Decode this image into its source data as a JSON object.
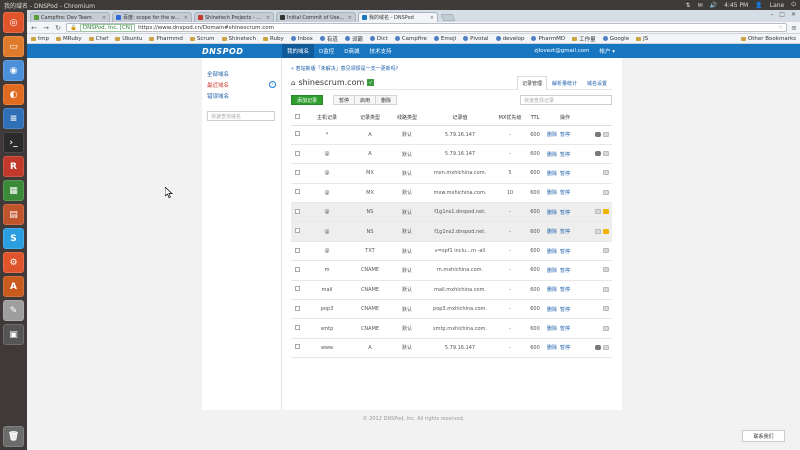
{
  "os_panel": {
    "window_title": "我的域名 - DNSPod - Chromium",
    "time": "4:45 PM",
    "user": "Lane"
  },
  "launcher": {
    "apps": [
      {
        "name": "dash-icon",
        "color": "#e0542c",
        "glyph": "◎"
      },
      {
        "name": "files-icon",
        "color": "#e07b2c",
        "glyph": "▭"
      },
      {
        "name": "chromium-icon",
        "color": "#4a8fd8",
        "glyph": "◉"
      },
      {
        "name": "firefox-icon",
        "color": "#e06a1f",
        "glyph": "◐"
      },
      {
        "name": "writer-icon",
        "color": "#2e6fb8",
        "glyph": "≡"
      },
      {
        "name": "terminal-icon",
        "color": "#2b2b2b",
        "glyph": "›_"
      },
      {
        "name": "rubymine-icon",
        "color": "#c0392b",
        "glyph": "R"
      },
      {
        "name": "calc-icon",
        "color": "#3a8a3a",
        "glyph": "▦"
      },
      {
        "name": "impress-icon",
        "color": "#c0542c",
        "glyph": "▤"
      },
      {
        "name": "skype-icon",
        "color": "#2a9ee0",
        "glyph": "S"
      },
      {
        "name": "settings-icon",
        "color": "#e0542c",
        "glyph": "⚙"
      },
      {
        "name": "software-center-icon",
        "color": "#c85a1e",
        "glyph": "A"
      },
      {
        "name": "editor-icon",
        "color": "#9e9e9e",
        "glyph": "✎"
      },
      {
        "name": "workspace-icon",
        "color": "#555555",
        "glyph": "▣"
      }
    ],
    "trash_glyph": "🗑"
  },
  "browser": {
    "tabs": [
      {
        "label": "Campfire: Dev Team",
        "fav": "#5a9e3a",
        "active": false
      },
      {
        "label": "百度: scope for the website",
        "fav": "#2f6bd8",
        "active": false
      },
      {
        "label": "Shinetech Projects - Pivotal",
        "fav": "#c43b30",
        "active": false
      },
      {
        "label": "Initial Commit of UserGuide",
        "fav": "#333333",
        "active": false
      },
      {
        "label": "我的域名 - DNSPod",
        "fav": "#1876c1",
        "active": true
      }
    ],
    "url_secure_label": "DNSPod, Inc. [CN]",
    "url": "https://www.dnspod.cn/Domain#shinescrum.com",
    "bookmarks": [
      {
        "label": "tmp",
        "type": "folder"
      },
      {
        "label": "MRuby",
        "type": "folder"
      },
      {
        "label": "Chef",
        "type": "folder"
      },
      {
        "label": "Ubuntu",
        "type": "folder"
      },
      {
        "label": "Pharmmd",
        "type": "folder"
      },
      {
        "label": "Scrum",
        "type": "folder"
      },
      {
        "label": "Shinetech",
        "type": "folder"
      },
      {
        "label": "Ruby",
        "type": "folder"
      },
      {
        "label": "Inbox",
        "type": "site"
      },
      {
        "label": "有道",
        "type": "site"
      },
      {
        "label": "词霸",
        "type": "site"
      },
      {
        "label": "Dict",
        "type": "site"
      },
      {
        "label": "Campfire",
        "type": "site"
      },
      {
        "label": "Emoji",
        "type": "site"
      },
      {
        "label": "Pivotal",
        "type": "site"
      },
      {
        "label": "develop",
        "type": "site"
      },
      {
        "label": "PharmMD",
        "type": "site"
      },
      {
        "label": "工作量",
        "type": "folder"
      },
      {
        "label": "Google",
        "type": "site"
      },
      {
        "label": "JS",
        "type": "folder"
      }
    ],
    "other_bookmarks": "Other Bookmarks"
  },
  "site": {
    "logo": "DNSPOD",
    "nav": [
      {
        "label": "我的域名",
        "active": true
      },
      {
        "label": "D监控",
        "active": false
      },
      {
        "label": "D商城",
        "active": false
      },
      {
        "label": "技术支持",
        "active": false
      }
    ],
    "user_email": "zjlovezt@gmail.com",
    "account_menu": "帐户 ▾",
    "sidebar": {
      "links": [
        {
          "label": "全部域名",
          "red": false
        },
        {
          "label": "最近域名",
          "red": true
        },
        {
          "label": "错误域名",
          "red": false
        }
      ],
      "search_placeholder": "快速查找域名"
    },
    "notice_prefix": "« 若站新版「未解决」意见领馈是一支一更新吗?",
    "domain": "shinescrum.com",
    "right_tabs": [
      {
        "label": "记录管理",
        "active": true
      },
      {
        "label": "解析量统计",
        "active": false
      },
      {
        "label": "域名设置",
        "active": false
      }
    ],
    "add_record": "添加记录",
    "bulk_actions": [
      "暂停",
      "启用",
      "删除"
    ],
    "record_search_placeholder": "快速查找记录",
    "table": {
      "headers": [
        "",
        "主机记录",
        "记录类型",
        "线路类型",
        "记录值",
        "MX优先级",
        "TTL",
        "操作",
        ""
      ],
      "op_delete": "删除",
      "op_pause": "暂停",
      "rows": [
        {
          "host": "*",
          "type": "A",
          "line": "默认",
          "value": "5.79.16.147",
          "mx": "-",
          "ttl": "600",
          "icons": [
            "cmt",
            "note"
          ]
        },
        {
          "host": "@",
          "type": "A",
          "line": "默认",
          "value": "5.79.16.147",
          "mx": "-",
          "ttl": "600",
          "icons": [
            "cmt",
            "note"
          ]
        },
        {
          "host": "@",
          "type": "MX",
          "line": "默认",
          "value": "mxn.mxhichina.com.",
          "mx": "5",
          "ttl": "600",
          "icons": [
            "note"
          ]
        },
        {
          "host": "@",
          "type": "MX",
          "line": "默认",
          "value": "mxw.mxhichina.com.",
          "mx": "10",
          "ttl": "600",
          "icons": [
            "note"
          ]
        },
        {
          "host": "@",
          "type": "NS",
          "line": "默认",
          "value": "f1g1ns1.dnspod.net.",
          "mx": "-",
          "ttl": "600",
          "icons": [
            "note",
            "lock"
          ],
          "ns": true
        },
        {
          "host": "@",
          "type": "NS",
          "line": "默认",
          "value": "f1g1ns2.dnspod.net.",
          "mx": "-",
          "ttl": "600",
          "icons": [
            "note",
            "lock"
          ],
          "ns": true
        },
        {
          "host": "@",
          "type": "TXT",
          "line": "默认",
          "value": "v=spf1 inclu…m -all",
          "mx": "-",
          "ttl": "600",
          "icons": [
            "note"
          ]
        },
        {
          "host": "m",
          "type": "CNAME",
          "line": "默认",
          "value": "m.mxhichina.com.",
          "mx": "-",
          "ttl": "600",
          "icons": [
            "note"
          ]
        },
        {
          "host": "mail",
          "type": "CNAME",
          "line": "默认",
          "value": "mail.mxhichina.com.",
          "mx": "-",
          "ttl": "600",
          "icons": [
            "note"
          ]
        },
        {
          "host": "pop3",
          "type": "CNAME",
          "line": "默认",
          "value": "pop3.mxhichina.com.",
          "mx": "-",
          "ttl": "600",
          "icons": [
            "note"
          ]
        },
        {
          "host": "smtp",
          "type": "CNAME",
          "line": "默认",
          "value": "smtp.mxhichina.com.",
          "mx": "-",
          "ttl": "600",
          "icons": [
            "note"
          ]
        },
        {
          "host": "www",
          "type": "A",
          "line": "默认",
          "value": "5.79.16.147",
          "mx": "-",
          "ttl": "600",
          "icons": [
            "cmt",
            "note"
          ]
        }
      ]
    },
    "copyright": "© 2012 DNSPod, Inc. All rights reserved.",
    "contact": "联系我们"
  }
}
